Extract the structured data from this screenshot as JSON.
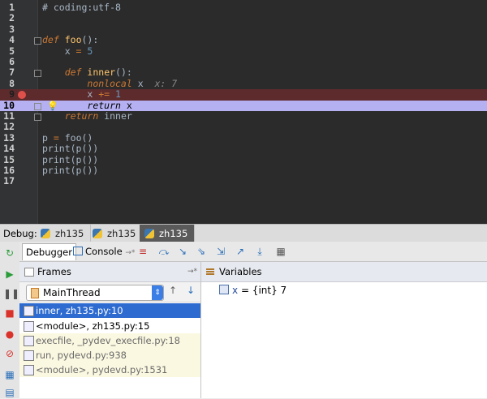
{
  "editor": {
    "lines": [
      {
        "n": "1",
        "text": "# coding:utf-8"
      },
      {
        "n": "2",
        "text": ""
      },
      {
        "n": "3",
        "text": ""
      },
      {
        "n": "4",
        "text": "def foo():"
      },
      {
        "n": "5",
        "text": "    x = 5"
      },
      {
        "n": "6",
        "text": ""
      },
      {
        "n": "7",
        "text": "    def inner():"
      },
      {
        "n": "8",
        "text": "        nonlocal x  x: 7"
      },
      {
        "n": "9",
        "text": "        x += 1"
      },
      {
        "n": "10",
        "text": "        return x"
      },
      {
        "n": "11",
        "text": "    return inner"
      },
      {
        "n": "12",
        "text": ""
      },
      {
        "n": "13",
        "text": "p = foo()"
      },
      {
        "n": "14",
        "text": "print(p())"
      },
      {
        "n": "15",
        "text": "print(p())"
      },
      {
        "n": "16",
        "text": "print(p())"
      },
      {
        "n": "17",
        "text": ""
      }
    ]
  },
  "debug_tabs": {
    "label": "Debug:",
    "tabs": [
      "zh135",
      "zh135",
      "zh135"
    ]
  },
  "toolbar": {
    "debugger_label": "Debugger",
    "console_label": "Console"
  },
  "frames": {
    "header": "Frames",
    "thread": "MainThread",
    "items": [
      "inner, zh135.py:10",
      "<module>, zh135.py:15",
      "execfile, _pydev_execfile.py:18",
      "run, pydevd.py:938",
      "<module>, pydevd.py:1531"
    ]
  },
  "variables": {
    "header": "Variables",
    "items": [
      {
        "name": "x",
        "value": "= {int} 7"
      }
    ]
  }
}
